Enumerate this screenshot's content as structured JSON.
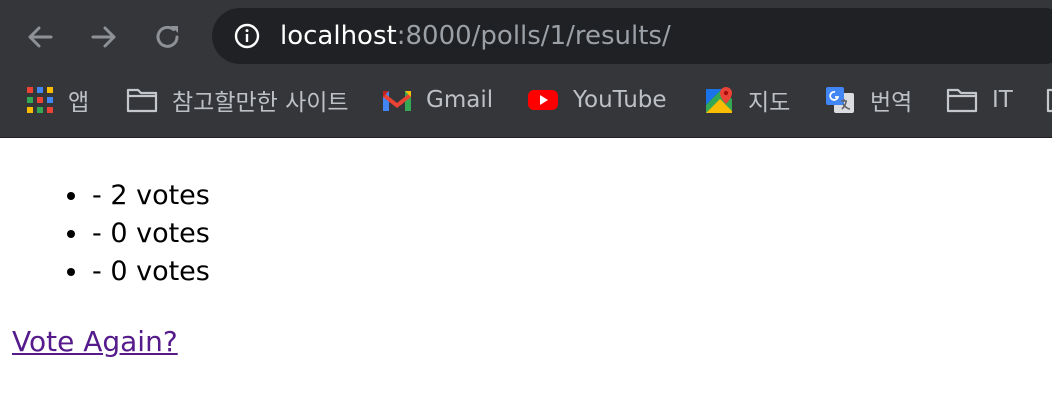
{
  "browser": {
    "url_host": "localhost",
    "url_rest": ":8000/polls/1/results/",
    "bookmarks": [
      {
        "label": "앱",
        "icon": "apps-grid-icon"
      },
      {
        "label": "참고할만한 사이트",
        "icon": "folder-icon"
      },
      {
        "label": "Gmail",
        "icon": "gmail-icon"
      },
      {
        "label": "YouTube",
        "icon": "youtube-icon"
      },
      {
        "label": "지도",
        "icon": "maps-icon"
      },
      {
        "label": "번역",
        "icon": "translate-icon"
      },
      {
        "label": "IT",
        "icon": "folder-icon"
      }
    ]
  },
  "page": {
    "choices": [
      {
        "text": "- 2 votes"
      },
      {
        "text": "- 0 votes"
      },
      {
        "text": "- 0 votes"
      }
    ],
    "vote_again_label": "Vote Again?"
  },
  "colors": {
    "chrome_bg": "#35363a",
    "omnibox_bg": "#202124",
    "link_visited": "#551a8b",
    "bookmark_text": "#bdc1c6"
  }
}
